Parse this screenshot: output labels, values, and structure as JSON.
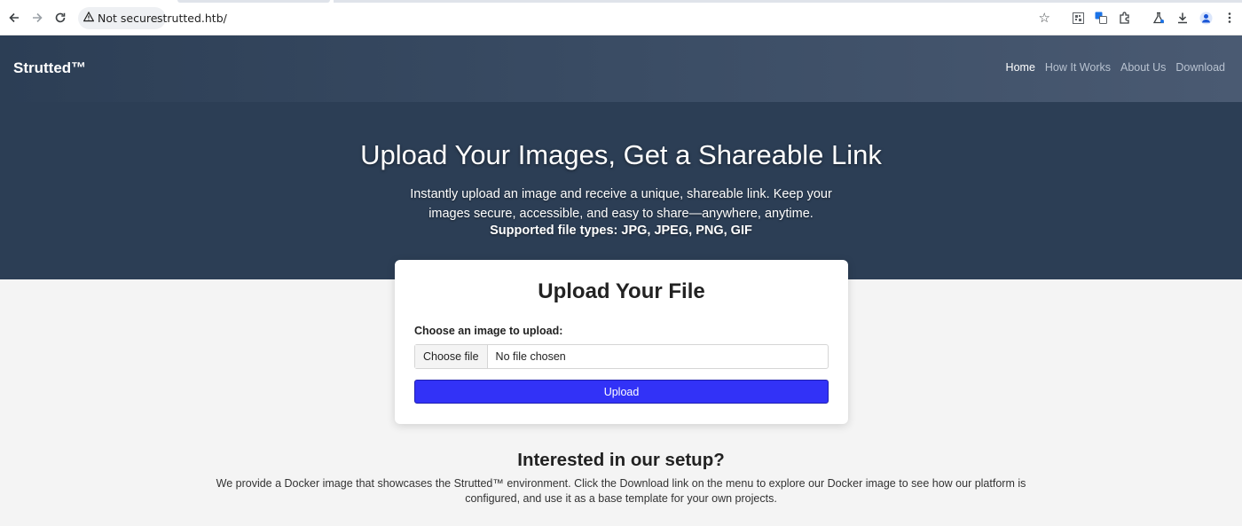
{
  "browser": {
    "security_label": "Not secure",
    "url": "strutted.htb/"
  },
  "site": {
    "brand": "Strutted™",
    "nav": [
      {
        "label": "Home",
        "active": true
      },
      {
        "label": "How It Works",
        "active": false
      },
      {
        "label": "About Us",
        "active": false
      },
      {
        "label": "Download",
        "active": false
      }
    ]
  },
  "hero": {
    "title": "Upload Your Images, Get a Shareable Link",
    "description": "Instantly upload an image and receive a unique, shareable link. Keep your images secure, accessible, and easy to share—anywhere, anytime.",
    "file_types": "Supported file types: JPG, JPEG, PNG, GIF"
  },
  "upload": {
    "title": "Upload Your File",
    "label": "Choose an image to upload:",
    "choose_button": "Choose file",
    "file_status": "No file chosen",
    "submit_label": "Upload"
  },
  "setup": {
    "title": "Interested in our setup?",
    "text": "We provide a Docker image that showcases the Strutted™ environment. Click the Download link on the menu to explore our Docker image to see how our platform is configured, and use it as a base template for your own projects."
  },
  "colors": {
    "header_bg": "#2c3e55",
    "upload_button": "#3232f7",
    "page_bg": "#f4f4f4"
  },
  "icons": [
    "back-arrow-icon",
    "forward-arrow-icon",
    "reload-icon",
    "warning-icon",
    "star-icon",
    "qr-code-icon",
    "translate-icon",
    "extensions-icon",
    "labs-icon",
    "download-icon",
    "profile-icon",
    "more-menu-icon"
  ]
}
